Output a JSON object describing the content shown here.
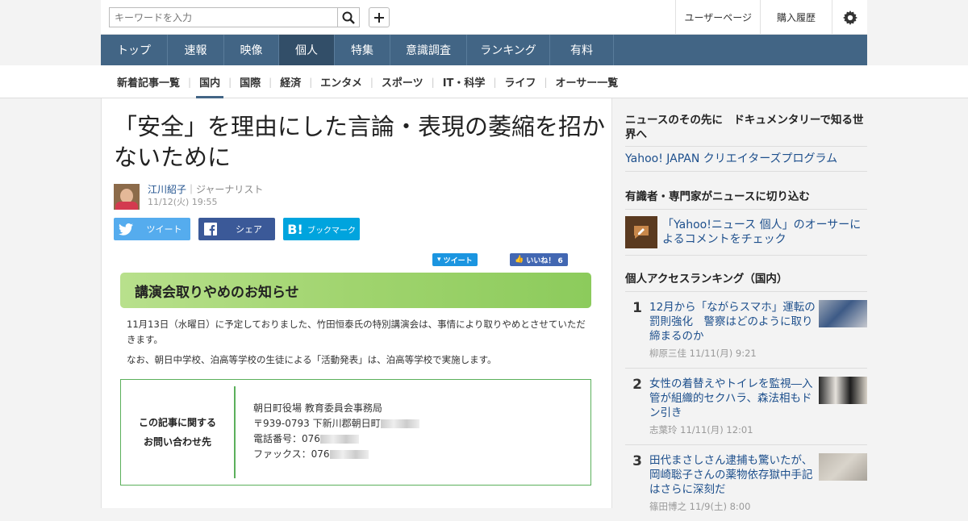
{
  "header": {
    "search_placeholder": "キーワードを入力",
    "links": [
      "ユーザーページ",
      "購入履歴"
    ]
  },
  "nav": [
    "トップ",
    "速報",
    "映像",
    "個人",
    "特集",
    "意識調査",
    "ランキング",
    "有料"
  ],
  "nav_active": "個人",
  "subnav": [
    "新着記事一覧",
    "国内",
    "国際",
    "経済",
    "エンタメ",
    "スポーツ",
    "IT・科学",
    "ライフ",
    "オーサー一覧"
  ],
  "subnav_active": "国内",
  "article": {
    "title": "「安全」を理由にした言論・表現の萎縮を招かないために",
    "author": "江川紹子",
    "role": "｜ジャーナリスト",
    "date": "11/12(火) 19:55",
    "share": {
      "tweet": "ツイート",
      "share": "シェア",
      "bookmark": "ブックマーク"
    },
    "figure": {
      "mini_tweet": "ツイート",
      "mini_like": "いいね！ 6",
      "banner": "講演会取りやめのお知らせ",
      "note1": "11月13日（水曜日）に予定しておりました、竹田恒泰氏の特別講演会は、事情により取りやめとさせていただきます。",
      "note2": "なお、朝日中学校、泊高等学校の生徒による「活動発表」は、泊高等学校で実施します。",
      "contact_label1": "この記事に関する",
      "contact_label2": "お問い合わせ先",
      "contact_org": "朝日町役場 教育委員会事務局",
      "contact_addr": "〒939-0793 下新川郡朝日町",
      "contact_tel": "電話番号：076",
      "contact_fax": "ファックス：076"
    }
  },
  "sidebar": {
    "sec1_title": "ニュースのその先に　ドキュメンタリーで知る世界へ",
    "sec1_link": "Yahoo! JAPAN クリエイターズプログラム",
    "sec2_title": "有識者・専門家がニュースに切り込む",
    "sec2_link": "「Yahoo!ニュース 個人」のオーサーによるコメントをチェック",
    "ranking_title": "個人アクセスランキング（国内）",
    "ranking": [
      {
        "rank": "1",
        "title": "12月から「ながらスマホ」運転の罰則強化　警察はどのように取り締まるのか",
        "meta": "柳原三佳  11/11(月) 9:21"
      },
      {
        "rank": "2",
        "title": "女性の着替えやトイレを監視―入管が組織的セクハラ、森法相もドン引き",
        "meta": "志葉玲  11/11(月) 12:01"
      },
      {
        "rank": "3",
        "title": "田代まさしさん逮捕も驚いたが、岡崎聡子さんの薬物依存獄中手記はさらに深刻だ",
        "meta": "篠田博之  11/9(土) 8:00"
      }
    ]
  },
  "colors": {
    "nav": "#426585",
    "nav_active": "#324e68",
    "link": "#1d4f8c",
    "twitter": "#55acee",
    "facebook": "#3b5998",
    "hatena": "#00a4de"
  }
}
